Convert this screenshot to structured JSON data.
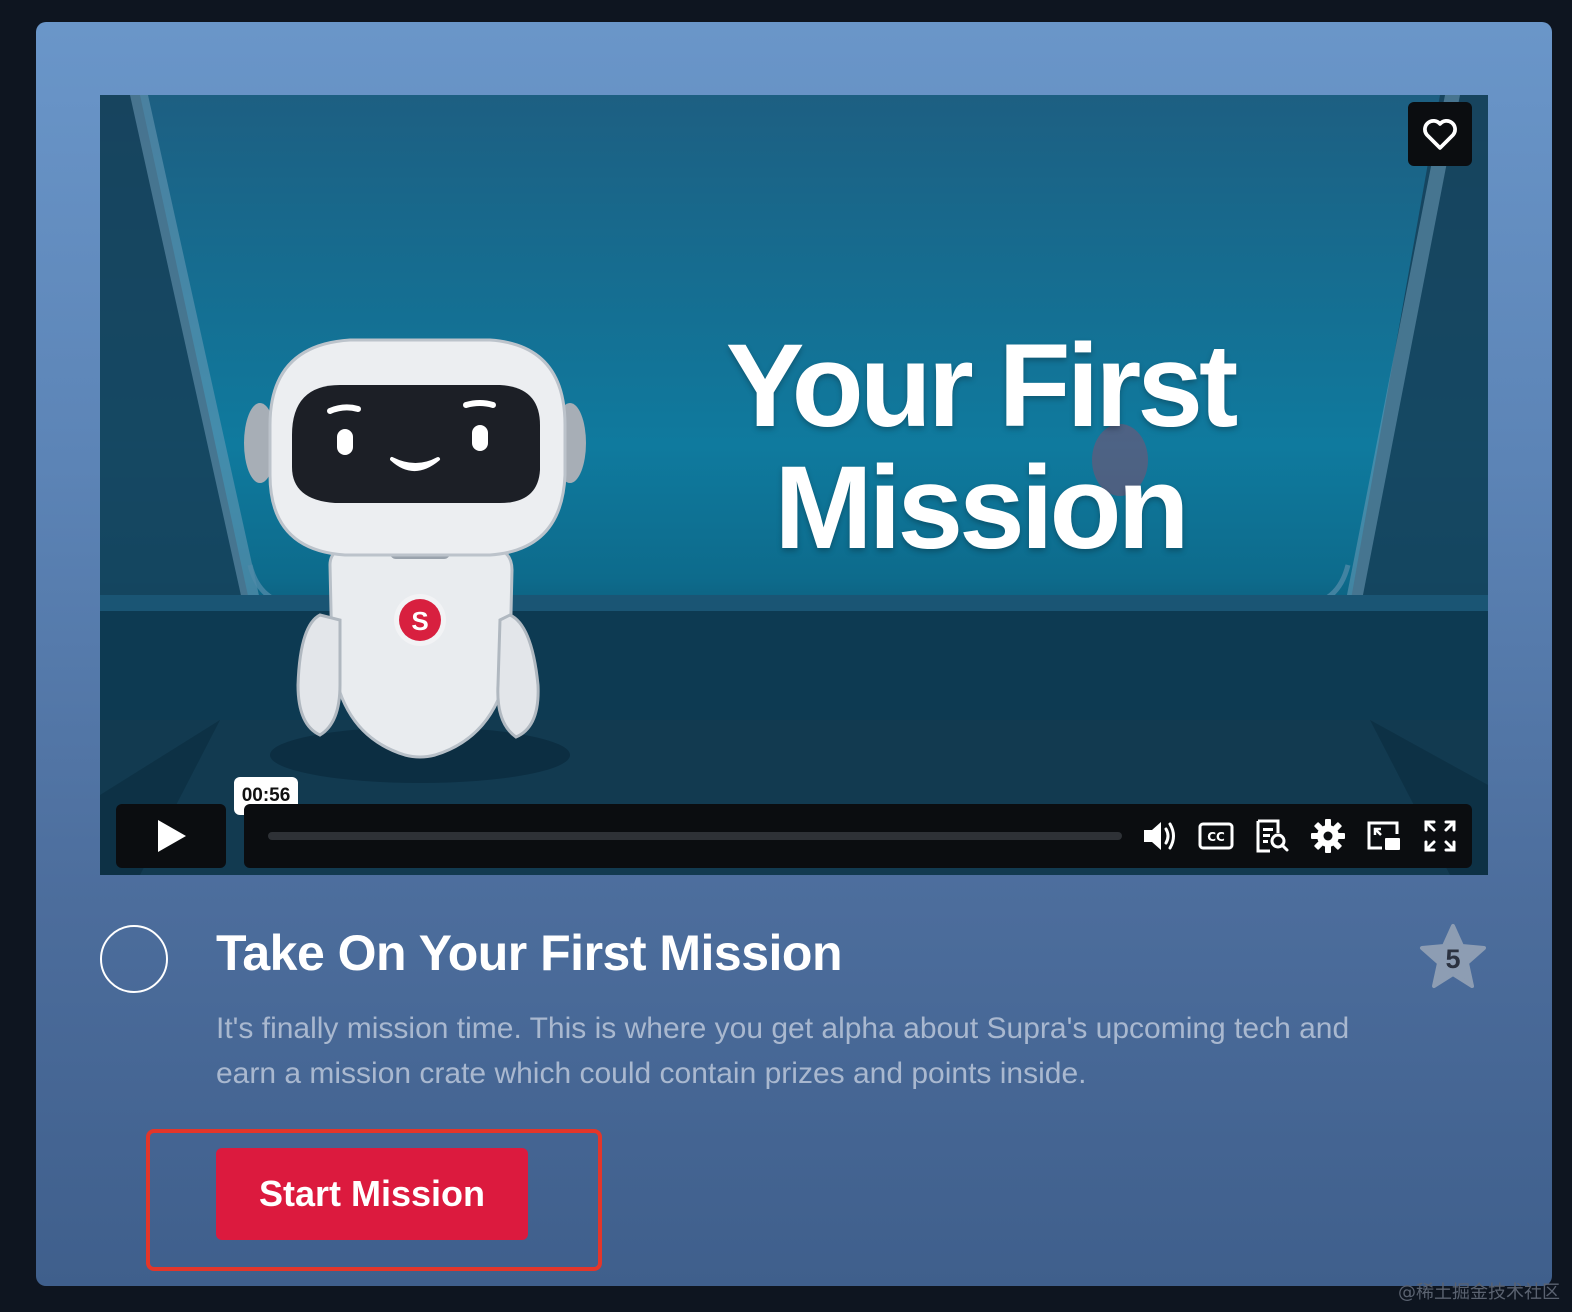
{
  "video": {
    "overlay_title": "Your First Mission",
    "timestamp_tooltip": "00:56",
    "progress": 0.0,
    "icons": {
      "favorite": "heart-icon",
      "play": "play-icon",
      "volume": "volume-icon",
      "captions": "captions-icon",
      "transcript": "transcript-icon",
      "settings": "gear-icon",
      "pip": "picture-in-picture-icon",
      "fullscreen": "fullscreen-icon"
    },
    "robot_badge": "S"
  },
  "mission": {
    "title": "Take On Your First Mission",
    "description": "It's finally mission time. This is where you get alpha about Supra's upcoming tech and earn a mission crate which could contain prizes and points inside.",
    "points": "5",
    "start_label": "Start Mission"
  },
  "colors": {
    "accent": "#dc1a3e",
    "highlight": "#e3362a",
    "card_top": "#6a96c9",
    "card_bottom": "#3f5f8c"
  },
  "watermark": "@稀土掘金技术社区"
}
